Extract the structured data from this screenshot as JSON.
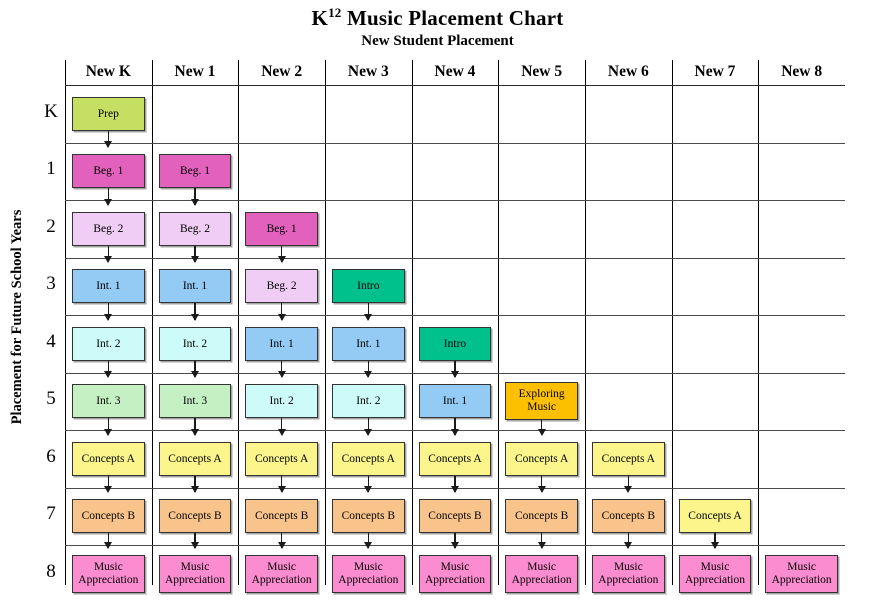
{
  "title": {
    "main_prefix": "K",
    "main_sup": "12",
    "main_rest": " Music Placement Chart",
    "subtitle": "New Student Placement"
  },
  "side_label": "Placement for Future School Years",
  "columns": [
    {
      "label": "New K"
    },
    {
      "label": "New 1"
    },
    {
      "label": "New 2"
    },
    {
      "label": "New 3"
    },
    {
      "label": "New 4"
    },
    {
      "label": "New 5"
    },
    {
      "label": "New 6"
    },
    {
      "label": "New 7"
    },
    {
      "label": "New 8"
    }
  ],
  "rows": [
    {
      "label": "K"
    },
    {
      "label": "1"
    },
    {
      "label": "2"
    },
    {
      "label": "3"
    },
    {
      "label": "4"
    },
    {
      "label": "5"
    },
    {
      "label": "6"
    },
    {
      "label": "7"
    },
    {
      "label": "8"
    }
  ],
  "course_colors": {
    "prep": "#c6df63",
    "beg1": "#e161bd",
    "beg2": "#f0cdf5",
    "int1": "#93cbf5",
    "int2": "#cdfbf9",
    "int3": "#c4f0c4",
    "intro": "#00c08b",
    "exploring_music": "#fcc000",
    "concepts_a": "#fbf58c",
    "concepts_b": "#f9c48c",
    "music_appreciation": "#fb8cd0"
  },
  "cells": [
    {
      "col": 0,
      "row": 0,
      "label": "Prep",
      "color_key": "prep",
      "lines": 1,
      "arrow_below": true
    },
    {
      "col": 0,
      "row": 1,
      "label": "Beg. 1",
      "color_key": "beg1",
      "lines": 1,
      "arrow_below": true
    },
    {
      "col": 0,
      "row": 2,
      "label": "Beg. 2",
      "color_key": "beg2",
      "lines": 1,
      "arrow_below": true
    },
    {
      "col": 0,
      "row": 3,
      "label": "Int. 1",
      "color_key": "int1",
      "lines": 1,
      "arrow_below": true
    },
    {
      "col": 0,
      "row": 4,
      "label": "Int. 2",
      "color_key": "int2",
      "lines": 1,
      "arrow_below": true
    },
    {
      "col": 0,
      "row": 5,
      "label": "Int. 3",
      "color_key": "int3",
      "lines": 1,
      "arrow_below": true
    },
    {
      "col": 0,
      "row": 6,
      "label": "Concepts A",
      "color_key": "concepts_a",
      "lines": 1,
      "arrow_below": true
    },
    {
      "col": 0,
      "row": 7,
      "label": "Concepts B",
      "color_key": "concepts_b",
      "lines": 1,
      "arrow_below": true
    },
    {
      "col": 0,
      "row": 8,
      "label": "Music Appreciation",
      "color_key": "music_appreciation",
      "lines": 2,
      "arrow_below": false
    },
    {
      "col": 1,
      "row": 1,
      "label": "Beg. 1",
      "color_key": "beg1",
      "lines": 1,
      "arrow_below": true
    },
    {
      "col": 1,
      "row": 2,
      "label": "Beg. 2",
      "color_key": "beg2",
      "lines": 1,
      "arrow_below": true
    },
    {
      "col": 1,
      "row": 3,
      "label": "Int. 1",
      "color_key": "int1",
      "lines": 1,
      "arrow_below": true
    },
    {
      "col": 1,
      "row": 4,
      "label": "Int. 2",
      "color_key": "int2",
      "lines": 1,
      "arrow_below": true
    },
    {
      "col": 1,
      "row": 5,
      "label": "Int. 3",
      "color_key": "int3",
      "lines": 1,
      "arrow_below": true
    },
    {
      "col": 1,
      "row": 6,
      "label": "Concepts A",
      "color_key": "concepts_a",
      "lines": 1,
      "arrow_below": true
    },
    {
      "col": 1,
      "row": 7,
      "label": "Concepts B",
      "color_key": "concepts_b",
      "lines": 1,
      "arrow_below": true
    },
    {
      "col": 1,
      "row": 8,
      "label": "Music Appreciation",
      "color_key": "music_appreciation",
      "lines": 2,
      "arrow_below": false
    },
    {
      "col": 2,
      "row": 2,
      "label": "Beg. 1",
      "color_key": "beg1",
      "lines": 1,
      "arrow_below": true
    },
    {
      "col": 2,
      "row": 3,
      "label": "Beg. 2",
      "color_key": "beg2",
      "lines": 1,
      "arrow_below": true
    },
    {
      "col": 2,
      "row": 4,
      "label": "Int. 1",
      "color_key": "int1",
      "lines": 1,
      "arrow_below": true
    },
    {
      "col": 2,
      "row": 5,
      "label": "Int. 2",
      "color_key": "int2",
      "lines": 1,
      "arrow_below": true
    },
    {
      "col": 2,
      "row": 6,
      "label": "Concepts A",
      "color_key": "concepts_a",
      "lines": 1,
      "arrow_below": true
    },
    {
      "col": 2,
      "row": 7,
      "label": "Concepts B",
      "color_key": "concepts_b",
      "lines": 1,
      "arrow_below": true
    },
    {
      "col": 2,
      "row": 8,
      "label": "Music Appreciation",
      "color_key": "music_appreciation",
      "lines": 2,
      "arrow_below": false
    },
    {
      "col": 3,
      "row": 3,
      "label": "Intro",
      "color_key": "intro",
      "lines": 1,
      "arrow_below": true
    },
    {
      "col": 3,
      "row": 4,
      "label": "Int. 1",
      "color_key": "int1",
      "lines": 1,
      "arrow_below": true
    },
    {
      "col": 3,
      "row": 5,
      "label": "Int. 2",
      "color_key": "int2",
      "lines": 1,
      "arrow_below": true
    },
    {
      "col": 3,
      "row": 6,
      "label": "Concepts A",
      "color_key": "concepts_a",
      "lines": 1,
      "arrow_below": true
    },
    {
      "col": 3,
      "row": 7,
      "label": "Concepts B",
      "color_key": "concepts_b",
      "lines": 1,
      "arrow_below": true
    },
    {
      "col": 3,
      "row": 8,
      "label": "Music Appreciation",
      "color_key": "music_appreciation",
      "lines": 2,
      "arrow_below": false
    },
    {
      "col": 4,
      "row": 4,
      "label": "Intro",
      "color_key": "intro",
      "lines": 1,
      "arrow_below": true
    },
    {
      "col": 4,
      "row": 5,
      "label": "Int. 1",
      "color_key": "int1",
      "lines": 1,
      "arrow_below": true
    },
    {
      "col": 4,
      "row": 6,
      "label": "Concepts A",
      "color_key": "concepts_a",
      "lines": 1,
      "arrow_below": true
    },
    {
      "col": 4,
      "row": 7,
      "label": "Concepts B",
      "color_key": "concepts_b",
      "lines": 1,
      "arrow_below": true
    },
    {
      "col": 4,
      "row": 8,
      "label": "Music Appreciation",
      "color_key": "music_appreciation",
      "lines": 2,
      "arrow_below": false
    },
    {
      "col": 5,
      "row": 5,
      "label": "Exploring Music",
      "color_key": "exploring_music",
      "lines": 2,
      "arrow_below": true
    },
    {
      "col": 5,
      "row": 6,
      "label": "Concepts A",
      "color_key": "concepts_a",
      "lines": 1,
      "arrow_below": true
    },
    {
      "col": 5,
      "row": 7,
      "label": "Concepts B",
      "color_key": "concepts_b",
      "lines": 1,
      "arrow_below": true
    },
    {
      "col": 5,
      "row": 8,
      "label": "Music Appreciation",
      "color_key": "music_appreciation",
      "lines": 2,
      "arrow_below": false
    },
    {
      "col": 6,
      "row": 6,
      "label": "Concepts A",
      "color_key": "concepts_a",
      "lines": 1,
      "arrow_below": true
    },
    {
      "col": 6,
      "row": 7,
      "label": "Concepts B",
      "color_key": "concepts_b",
      "lines": 1,
      "arrow_below": true
    },
    {
      "col": 6,
      "row": 8,
      "label": "Music Appreciation",
      "color_key": "music_appreciation",
      "lines": 2,
      "arrow_below": false
    },
    {
      "col": 7,
      "row": 7,
      "label": "Concepts A",
      "color_key": "concepts_a",
      "lines": 1,
      "arrow_below": true
    },
    {
      "col": 7,
      "row": 8,
      "label": "Music Appreciation",
      "color_key": "music_appreciation",
      "lines": 2,
      "arrow_below": false
    },
    {
      "col": 8,
      "row": 8,
      "label": "Music Appreciation",
      "color_key": "music_appreciation",
      "lines": 2,
      "arrow_below": false
    }
  ]
}
